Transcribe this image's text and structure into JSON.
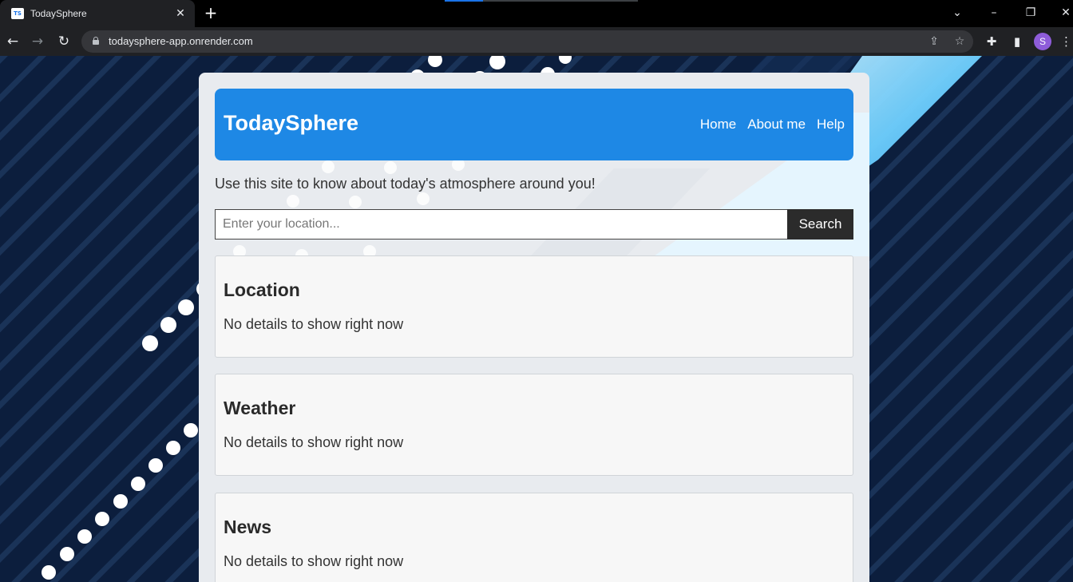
{
  "browser": {
    "tab_title": "TodaySphere",
    "favicon_text": "TS",
    "url": "todaysphere-app.onrender.com",
    "profile_initial": "S",
    "icons": {
      "tab_close": "close-icon",
      "new_tab": "plus-icon",
      "back": "arrow-left-icon",
      "forward": "arrow-right-icon",
      "reload": "reload-icon",
      "lock": "lock-icon",
      "share": "share-icon",
      "bookmark": "star-icon",
      "extensions": "puzzle-icon",
      "side_panel": "side-panel-icon",
      "menu": "kebab-menu-icon"
    }
  },
  "site": {
    "title": "TodaySphere",
    "nav": [
      "Home",
      "About me",
      "Help"
    ],
    "intro": "Use this site to know about today's atmosphere around you!",
    "search": {
      "placeholder": "Enter your location...",
      "button_label": "Search"
    },
    "cards": [
      {
        "title": "Location",
        "body": "No details to show right now"
      },
      {
        "title": "Weather",
        "body": "No details to show right now"
      },
      {
        "title": "News",
        "body": "No details to show right now"
      }
    ]
  },
  "colors": {
    "header_blue": "#1e88e5",
    "background_navy": "#0a1a36",
    "accent_cyan": "#29b6f6",
    "button_dark": "#2b2b2b"
  }
}
